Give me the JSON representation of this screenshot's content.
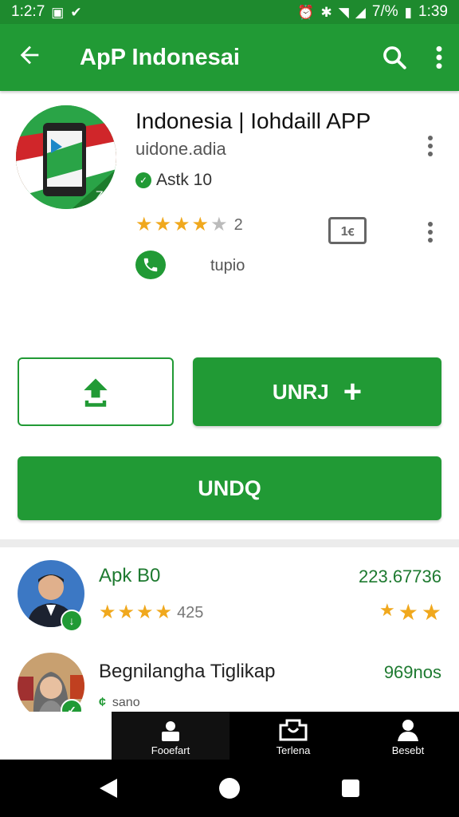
{
  "status_bar": {
    "time_left": "1:2:7",
    "battery_pct": "7/%",
    "time_right": "1:39"
  },
  "app_bar": {
    "title": "ApP Indonesai"
  },
  "app": {
    "name": "Indonesia | Iohdaill APP",
    "developer": "uidone.adia",
    "age_badge": "Astk 10",
    "rating_count": "2",
    "rating_stars": 4,
    "book_label": "1ꞓ",
    "phone_label": "tupio"
  },
  "buttons": {
    "install_label": "UNRJ",
    "undo_label": "UNDQ"
  },
  "list": [
    {
      "title": "Apk B0",
      "count": "223.67736",
      "stars": 4,
      "stars_text": "425"
    },
    {
      "title": "Begnilangha Tiglikap",
      "count": "969nos",
      "sub_text": "sano"
    }
  ],
  "bottom_nav": [
    {
      "label": "Fooefart",
      "icon": "home-icon"
    },
    {
      "label": "Terlena",
      "icon": "inbox-icon"
    },
    {
      "label": "Besebt",
      "icon": "person-icon"
    }
  ],
  "colors": {
    "brand_green": "#219a35",
    "star": "#f0a81d"
  }
}
